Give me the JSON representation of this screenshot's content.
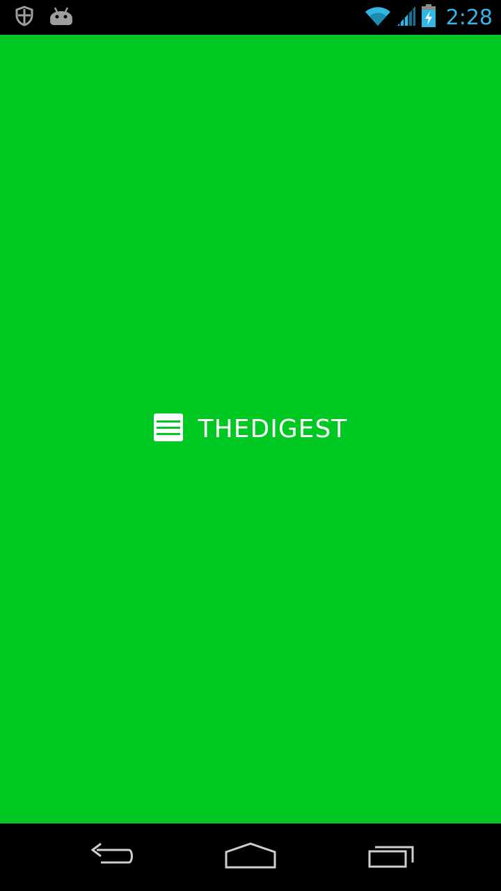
{
  "status_bar": {
    "time": "2:28",
    "icons": [
      "shield-icon",
      "android-icon",
      "wifi-icon",
      "signal-icon",
      "battery-charging-icon"
    ],
    "accent_color": "#33b5e5"
  },
  "splash": {
    "background_color": "#00c823",
    "logo_icon": "menu-lines-icon",
    "brand_name": "THEDIGEST"
  },
  "nav_bar": {
    "buttons": [
      "back-icon",
      "home-icon",
      "recents-icon"
    ]
  }
}
